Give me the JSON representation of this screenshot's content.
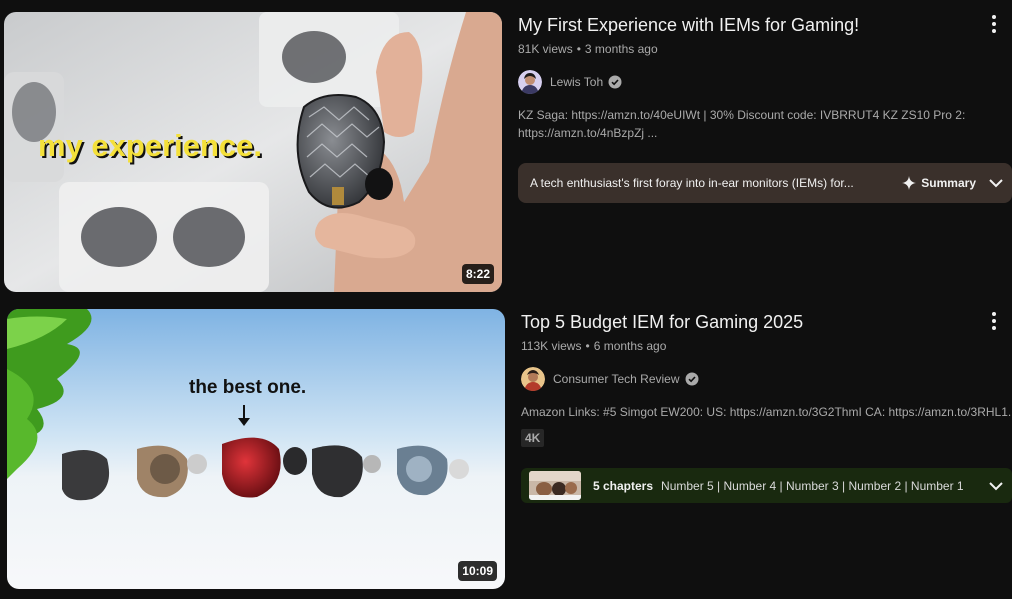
{
  "videos": [
    {
      "title": "My First Experience with IEMs for Gaming!",
      "views": "81K views",
      "age": "3 months ago",
      "channel": "Lewis Toh",
      "verified": true,
      "description": "KZ Saga: https://amzn.to/40eUIWt | 30% Discount code: IVBRRUT4 KZ ZS10 Pro 2: https://amzn.to/4nBzpZj ...",
      "duration": "8:22",
      "thumbnail_caption": "my experience.",
      "summary": {
        "text": "A tech enthusiast's first foray into in-ear monitors (IEMs) for...",
        "button_label": "Summary"
      }
    },
    {
      "title": "Top 5 Budget IEM for Gaming 2025",
      "views": "113K views",
      "age": "6 months ago",
      "channel": "Consumer Tech Review",
      "verified": true,
      "description": "Amazon Links: #5 Simgot EW200: US: https://amzn.to/3G2ThmI CA: https://amzn.to/3RHL1...",
      "badge": "4K",
      "duration": "10:09",
      "thumbnail_caption": "the best one.",
      "chapters": {
        "count": "5 chapters",
        "list": "Number 5 | Number 4 | Number 3 | Number 2 | Number 1"
      }
    }
  ],
  "colors": {
    "background": "#0f0f0f",
    "summary_bg": "#3a302b",
    "chapters_bg": "#19290f",
    "caption_yellow": "#f4e03a"
  }
}
